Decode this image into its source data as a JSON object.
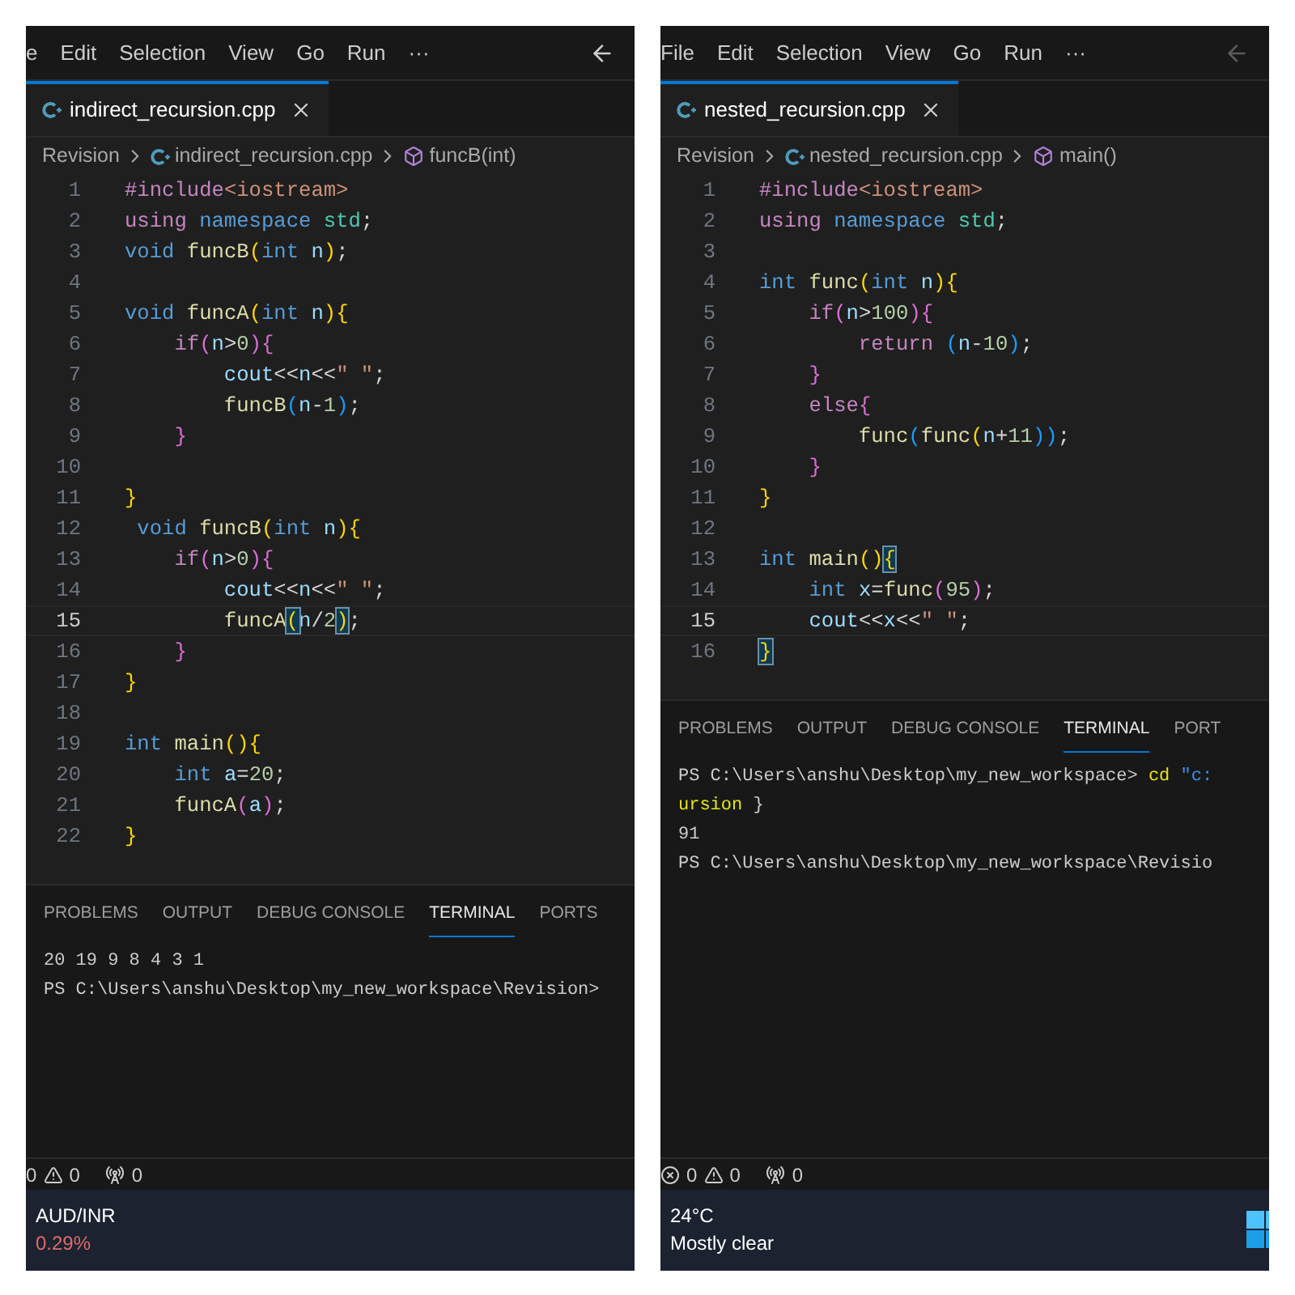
{
  "panes": [
    {
      "menu": [
        "e",
        "Edit",
        "Selection",
        "View",
        "Go",
        "Run",
        "···"
      ],
      "back_enabled": true,
      "tab": {
        "label": "indirect_recursion.cpp",
        "selected": true
      },
      "breadcrumb": {
        "folder": "Revision",
        "file": "indirect_recursion.cpp",
        "symbol": "funcB(int)"
      },
      "code": [
        {
          "number": "1",
          "current": false,
          "tokens": [
            {
              "text": "#include",
              "kind": "directive"
            },
            {
              "text": "<iostream>",
              "kind": "header"
            }
          ]
        },
        {
          "number": "2",
          "current": false,
          "tokens": [
            {
              "text": "using ",
              "kind": "control"
            },
            {
              "text": "namespace ",
              "kind": "keyword"
            },
            {
              "text": "std",
              "kind": "type"
            },
            {
              "text": ";",
              "kind": "plain"
            }
          ]
        },
        {
          "number": "3",
          "current": false,
          "tokens": [
            {
              "text": "void ",
              "kind": "keyword"
            },
            {
              "text": "funcB",
              "kind": "function"
            },
            {
              "text": "(",
              "kind": "bracket1"
            },
            {
              "text": "int ",
              "kind": "keyword"
            },
            {
              "text": "n",
              "kind": "variable"
            },
            {
              "text": ")",
              "kind": "bracket1"
            },
            {
              "text": ";",
              "kind": "plain"
            }
          ]
        },
        {
          "number": "4",
          "current": false
        },
        {
          "number": "5",
          "current": false,
          "tokens": [
            {
              "text": "void ",
              "kind": "keyword"
            },
            {
              "text": "funcA",
              "kind": "function"
            },
            {
              "text": "(",
              "kind": "bracket1"
            },
            {
              "text": "int ",
              "kind": "keyword"
            },
            {
              "text": "n",
              "kind": "variable"
            },
            {
              "text": "){",
              "kind": "bracket1"
            }
          ]
        },
        {
          "number": "6",
          "current": false,
          "tokens": [
            {
              "text": "    if",
              "kind": "control"
            },
            {
              "text": "(",
              "kind": "bracket2"
            },
            {
              "text": "n",
              "kind": "variable"
            },
            {
              "text": ">",
              "kind": "plain"
            },
            {
              "text": "0",
              "kind": "number"
            },
            {
              "text": "){",
              "kind": "bracket2"
            }
          ]
        },
        {
          "number": "7",
          "current": false,
          "tokens": [
            {
              "text": "        cout",
              "kind": "variable"
            },
            {
              "text": "<<",
              "kind": "plain"
            },
            {
              "text": "n",
              "kind": "variable"
            },
            {
              "text": "<<",
              "kind": "plain"
            },
            {
              "text": "\" \"",
              "kind": "string"
            },
            {
              "text": ";",
              "kind": "plain"
            }
          ]
        },
        {
          "number": "8",
          "current": false,
          "tokens": [
            {
              "text": "        funcB",
              "kind": "function"
            },
            {
              "text": "(",
              "kind": "bracket3"
            },
            {
              "text": "n",
              "kind": "variable"
            },
            {
              "text": "-",
              "kind": "plain"
            },
            {
              "text": "1",
              "kind": "number"
            },
            {
              "text": ")",
              "kind": "bracket3"
            },
            {
              "text": ";",
              "kind": "plain"
            }
          ]
        },
        {
          "number": "9",
          "current": false,
          "tokens": [
            {
              "text": "    }",
              "kind": "bracket2"
            }
          ]
        },
        {
          "number": "10",
          "current": false
        },
        {
          "number": "11",
          "current": false,
          "tokens": [
            {
              "text": "}",
              "kind": "bracket1"
            }
          ]
        },
        {
          "number": "12",
          "current": false,
          "tokens": [
            {
              "text": " void ",
              "kind": "keyword"
            },
            {
              "text": "funcB",
              "kind": "function"
            },
            {
              "text": "(",
              "kind": "bracket1"
            },
            {
              "text": "int ",
              "kind": "keyword"
            },
            {
              "text": "n",
              "kind": "variable"
            },
            {
              "text": "){",
              "kind": "bracket1"
            }
          ]
        },
        {
          "number": "13",
          "current": false,
          "tokens": [
            {
              "text": "    if",
              "kind": "control"
            },
            {
              "text": "(",
              "kind": "bracket2"
            },
            {
              "text": "n",
              "kind": "variable"
            },
            {
              "text": ">",
              "kind": "plain"
            },
            {
              "text": "0",
              "kind": "number"
            },
            {
              "text": "){",
              "kind": "bracket2"
            }
          ]
        },
        {
          "number": "14",
          "current": false,
          "tokens": [
            {
              "text": "        cout",
              "kind": "variable"
            },
            {
              "text": "<<",
              "kind": "plain"
            },
            {
              "text": "n",
              "kind": "variable"
            },
            {
              "text": "<<",
              "kind": "plain"
            },
            {
              "text": "\" \"",
              "kind": "string"
            },
            {
              "text": ";",
              "kind": "plain"
            }
          ]
        },
        {
          "number": "15",
          "current": true,
          "tokens": [
            {
              "text": "        funcA",
              "kind": "function"
            },
            {
              "text": "(",
              "kind": "match"
            },
            {
              "text": "n",
              "kind": "variable"
            },
            {
              "text": "/",
              "kind": "plain"
            },
            {
              "text": "2",
              "kind": "number"
            },
            {
              "text": ")",
              "kind": "match"
            },
            {
              "text": ";",
              "kind": "plain"
            }
          ]
        },
        {
          "number": "16",
          "current": false,
          "tokens": [
            {
              "text": "    }",
              "kind": "bracket2"
            }
          ]
        },
        {
          "number": "17",
          "current": false,
          "tokens": [
            {
              "text": "}",
              "kind": "bracket1"
            }
          ]
        },
        {
          "number": "18",
          "current": false
        },
        {
          "number": "19",
          "current": false,
          "tokens": [
            {
              "text": "int ",
              "kind": "keyword"
            },
            {
              "text": "main",
              "kind": "function"
            },
            {
              "text": "(){",
              "kind": "bracket1"
            }
          ]
        },
        {
          "number": "20",
          "current": false,
          "tokens": [
            {
              "text": "    int ",
              "kind": "keyword"
            },
            {
              "text": "a",
              "kind": "variable"
            },
            {
              "text": "=",
              "kind": "plain"
            },
            {
              "text": "20",
              "kind": "number"
            },
            {
              "text": ";",
              "kind": "plain"
            }
          ]
        },
        {
          "number": "21",
          "current": false,
          "tokens": [
            {
              "text": "    funcA",
              "kind": "function"
            },
            {
              "text": "(",
              "kind": "bracket2"
            },
            {
              "text": "a",
              "kind": "variable"
            },
            {
              "text": ")",
              "kind": "bracket2"
            },
            {
              "text": ";",
              "kind": "plain"
            }
          ]
        },
        {
          "number": "22",
          "current": false,
          "tokens": [
            {
              "text": "}",
              "kind": "bracket1"
            }
          ]
        }
      ],
      "panel_tabs": [
        {
          "label": "PROBLEMS",
          "selected": false
        },
        {
          "label": "OUTPUT",
          "selected": false
        },
        {
          "label": "DEBUG CONSOLE",
          "selected": false
        },
        {
          "label": "TERMINAL",
          "selected": true
        },
        {
          "label": "PORTS",
          "selected": false
        }
      ],
      "terminal": [
        [
          {
            "text": "20 19 9 8 4 3 1",
            "kind": "plain"
          }
        ],
        [
          {
            "text": "PS C:\\Users\\anshu\\Desktop\\my_new_workspace\\Revision>",
            "kind": "plain"
          }
        ]
      ],
      "status": {
        "errors_icon": false,
        "errors": "0",
        "warnings": "0",
        "ports": "0"
      },
      "taskbar": {
        "title": "AUD/INR",
        "subtitle": "0.29%",
        "negative": true,
        "start_button": false
      }
    },
    {
      "menu": [
        "File",
        "Edit",
        "Selection",
        "View",
        "Go",
        "Run",
        "···"
      ],
      "back_enabled": false,
      "tab": {
        "label": "nested_recursion.cpp",
        "selected": true
      },
      "breadcrumb": {
        "folder": "Revision",
        "file": "nested_recursion.cpp",
        "symbol": "main()"
      },
      "code": [
        {
          "number": "1",
          "current": false,
          "tokens": [
            {
              "text": "#include",
              "kind": "directive"
            },
            {
              "text": "<iostream>",
              "kind": "header"
            }
          ]
        },
        {
          "number": "2",
          "current": false,
          "tokens": [
            {
              "text": "using ",
              "kind": "control"
            },
            {
              "text": "namespace ",
              "kind": "keyword"
            },
            {
              "text": "std",
              "kind": "type"
            },
            {
              "text": ";",
              "kind": "plain"
            }
          ]
        },
        {
          "number": "3",
          "current": false
        },
        {
          "number": "4",
          "current": false,
          "tokens": [
            {
              "text": "int ",
              "kind": "keyword"
            },
            {
              "text": "func",
              "kind": "function"
            },
            {
              "text": "(",
              "kind": "bracket1"
            },
            {
              "text": "int ",
              "kind": "keyword"
            },
            {
              "text": "n",
              "kind": "variable"
            },
            {
              "text": "){",
              "kind": "bracket1"
            }
          ]
        },
        {
          "number": "5",
          "current": false,
          "tokens": [
            {
              "text": "    if",
              "kind": "control"
            },
            {
              "text": "(",
              "kind": "bracket2"
            },
            {
              "text": "n",
              "kind": "variable"
            },
            {
              "text": ">",
              "kind": "plain"
            },
            {
              "text": "100",
              "kind": "number"
            },
            {
              "text": "){",
              "kind": "bracket2"
            }
          ]
        },
        {
          "number": "6",
          "current": false,
          "tokens": [
            {
              "text": "        return ",
              "kind": "control"
            },
            {
              "text": "(",
              "kind": "bracket3"
            },
            {
              "text": "n",
              "kind": "variable"
            },
            {
              "text": "-",
              "kind": "plain"
            },
            {
              "text": "10",
              "kind": "number"
            },
            {
              "text": ")",
              "kind": "bracket3"
            },
            {
              "text": ";",
              "kind": "plain"
            }
          ]
        },
        {
          "number": "7",
          "current": false,
          "tokens": [
            {
              "text": "    }",
              "kind": "bracket2"
            }
          ]
        },
        {
          "number": "8",
          "current": false,
          "tokens": [
            {
              "text": "    else",
              "kind": "control"
            },
            {
              "text": "{",
              "kind": "bracket2"
            }
          ]
        },
        {
          "number": "9",
          "current": false,
          "tokens": [
            {
              "text": "        func",
              "kind": "function"
            },
            {
              "text": "(",
              "kind": "bracket3"
            },
            {
              "text": "func",
              "kind": "function"
            },
            {
              "text": "(",
              "kind": "bracket1"
            },
            {
              "text": "n",
              "kind": "variable"
            },
            {
              "text": "+",
              "kind": "plain"
            },
            {
              "text": "11",
              "kind": "number"
            },
            {
              "text": "))",
              "kind": "bracket3"
            },
            {
              "text": ";",
              "kind": "plain"
            }
          ]
        },
        {
          "number": "10",
          "current": false,
          "tokens": [
            {
              "text": "    }",
              "kind": "bracket2"
            }
          ]
        },
        {
          "number": "11",
          "current": false,
          "tokens": [
            {
              "text": "}",
              "kind": "bracket1"
            }
          ]
        },
        {
          "number": "12",
          "current": false
        },
        {
          "number": "13",
          "current": false,
          "tokens": [
            {
              "text": "int ",
              "kind": "keyword"
            },
            {
              "text": "main",
              "kind": "function"
            },
            {
              "text": "()",
              "kind": "bracket1"
            },
            {
              "text": "{",
              "kind": "match"
            }
          ]
        },
        {
          "number": "14",
          "current": false,
          "tokens": [
            {
              "text": "    int ",
              "kind": "keyword"
            },
            {
              "text": "x",
              "kind": "variable"
            },
            {
              "text": "=",
              "kind": "plain"
            },
            {
              "text": "func",
              "kind": "function"
            },
            {
              "text": "(",
              "kind": "bracket2"
            },
            {
              "text": "95",
              "kind": "number"
            },
            {
              "text": ")",
              "kind": "bracket2"
            },
            {
              "text": ";",
              "kind": "plain"
            }
          ]
        },
        {
          "number": "15",
          "current": true,
          "tokens": [
            {
              "text": "    cout",
              "kind": "variable"
            },
            {
              "text": "<<",
              "kind": "plain"
            },
            {
              "text": "x",
              "kind": "variable"
            },
            {
              "text": "<<",
              "kind": "plain"
            },
            {
              "text": "\" \"",
              "kind": "string"
            },
            {
              "text": ";",
              "kind": "plain"
            }
          ]
        },
        {
          "number": "16",
          "current": false,
          "tokens": [
            {
              "text": "}",
              "kind": "match"
            }
          ]
        }
      ],
      "panel_tabs": [
        {
          "label": "PROBLEMS",
          "selected": false
        },
        {
          "label": "OUTPUT",
          "selected": false
        },
        {
          "label": "DEBUG CONSOLE",
          "selected": false
        },
        {
          "label": "TERMINAL",
          "selected": true
        },
        {
          "label": "PORT",
          "selected": false
        }
      ],
      "terminal": [
        [
          {
            "text": "PS C:\\Users\\anshu\\Desktop\\my_new_workspace> ",
            "kind": "plain"
          },
          {
            "text": "cd",
            "kind": "command"
          },
          {
            "text": " \"c:",
            "kind": "argument"
          }
        ],
        [
          {
            "text": "ursion",
            "kind": "command"
          },
          {
            "text": " }",
            "kind": "plain"
          }
        ],
        [
          {
            "text": "91",
            "kind": "plain"
          }
        ],
        [
          {
            "text": "PS C:\\Users\\anshu\\Desktop\\my_new_workspace\\Revisio",
            "kind": "plain"
          }
        ]
      ],
      "status": {
        "errors_icon": true,
        "errors": "0",
        "warnings": "0",
        "ports": "0"
      },
      "taskbar": {
        "title": "24°C",
        "subtitle": "Mostly clear",
        "negative": false,
        "start_button": true
      }
    }
  ]
}
